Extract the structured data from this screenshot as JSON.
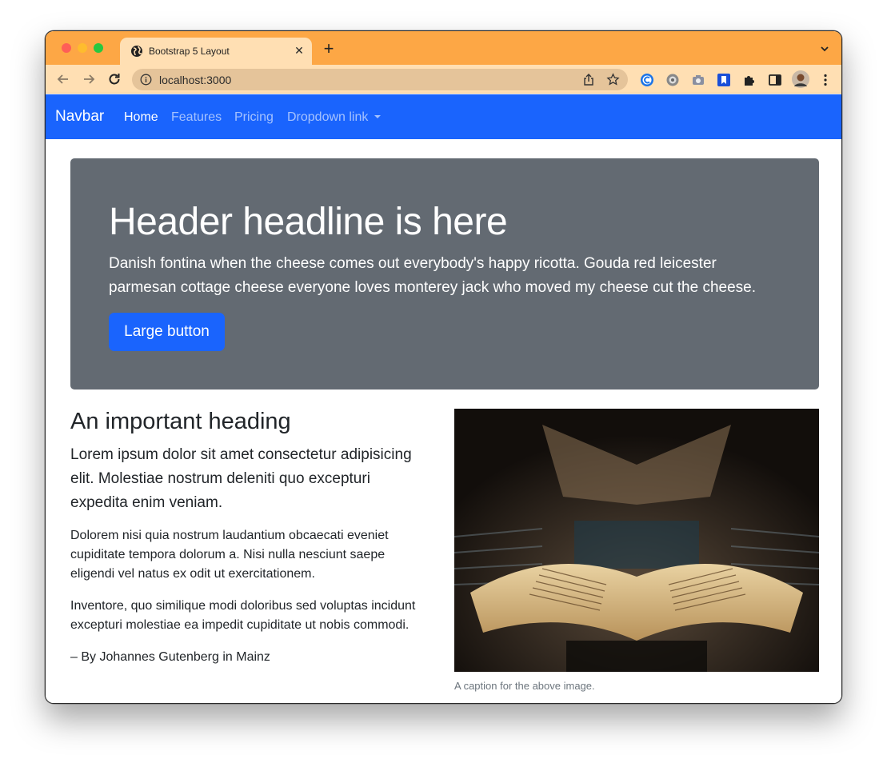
{
  "browser": {
    "tab_title": "Bootstrap 5 Layout",
    "tab_close": "✕",
    "new_tab": "+",
    "url": "localhost:3000"
  },
  "navbar": {
    "brand": "Navbar",
    "links": [
      "Home",
      "Features",
      "Pricing",
      "Dropdown link"
    ],
    "active": "Home",
    "color": "#1a64fd"
  },
  "hero": {
    "headline": "Header headline is here",
    "lead": "Danish fontina when the cheese comes out everybody's happy ricotta. Gouda red leicester parmesan cottage cheese everyone loves monterey jack who moved my cheese cut the cheese.",
    "button_label": "Large button",
    "background": "#636a72"
  },
  "article": {
    "heading": "An important heading",
    "lead": "Lorem ipsum dolor sit amet consectetur adipisicing elit. Molestiae nostrum deleniti quo excepturi expedita enim veniam.",
    "paragraphs": [
      "Dolorem nisi quia nostrum laudantium obcaecati eveniet cupiditate tempora dolorum a. Nisi nulla nesciunt saepe eligendi vel natus ex odit ut exercitationem.",
      "Inventore, quo similique modi doloribus sed voluptas incidunt excepturi molestiae ea impedit cupiditate ut nobis commodi."
    ],
    "byline": "– By Johannes Gutenberg in Mainz"
  },
  "figure": {
    "caption": "A caption for the above image."
  },
  "icons": {
    "favicon": "globe-icon",
    "back": "back-arrow-icon",
    "forward": "forward-arrow-icon",
    "reload": "reload-icon",
    "info": "info-icon",
    "share": "share-icon",
    "bookmark": "star-icon",
    "extensions": [
      "extension-c-icon",
      "extension-gear-icon",
      "camera-icon",
      "extension-bookmark-icon",
      "puzzle-icon",
      "sidebar-icon",
      "profile-avatar",
      "kebab-menu-icon"
    ]
  }
}
